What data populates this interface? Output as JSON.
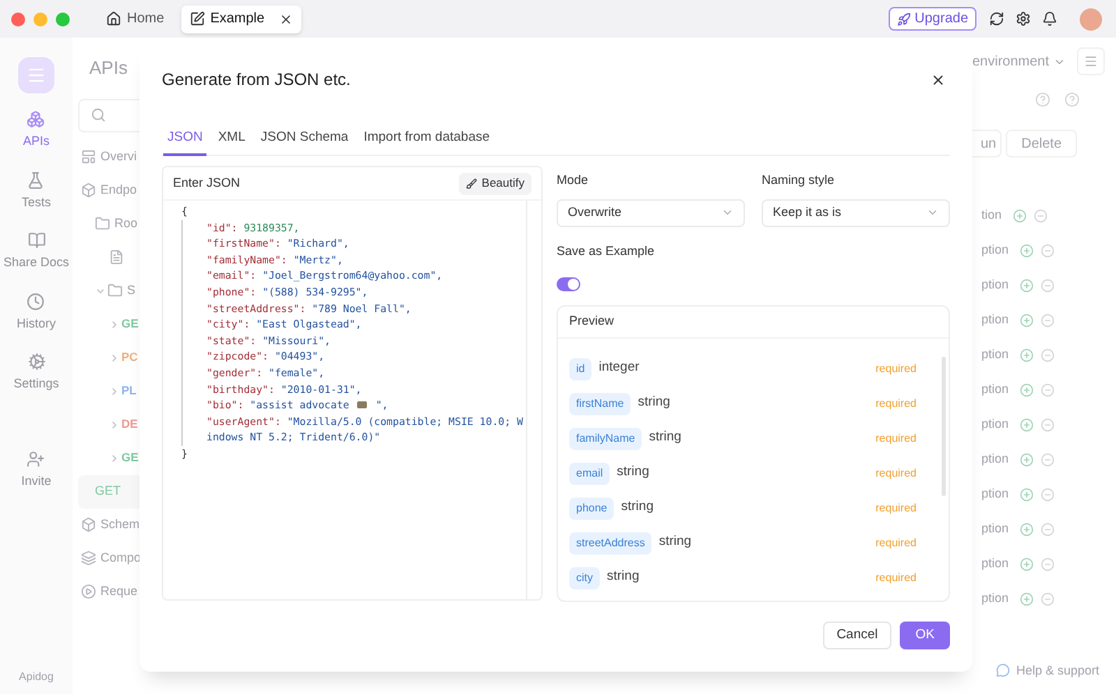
{
  "window_tabs": [
    {
      "label": "Home",
      "selected": false,
      "closable": false
    },
    {
      "label": "Example",
      "selected": true,
      "closable": true
    }
  ],
  "toolbar": {
    "upgrade": "Upgrade"
  },
  "sidebar": {
    "items": [
      {
        "label": "APIs",
        "selected": true
      },
      {
        "label": "Tests",
        "selected": false
      },
      {
        "label": "Share Docs",
        "selected": false
      },
      {
        "label": "History",
        "selected": false
      },
      {
        "label": "Settings",
        "selected": false
      },
      {
        "label": "Invite",
        "selected": false
      }
    ],
    "footer": "Apidog"
  },
  "nav": {
    "title": "APIs",
    "tree": [
      {
        "label": "Overvi",
        "kind": "page"
      },
      {
        "label": "Endpo",
        "kind": "group",
        "children": [
          {
            "label": "Roo",
            "kind": "folder",
            "children": [
              {
                "kind": "doc"
              },
              {
                "label": "S",
                "kind": "folder",
                "expanded": true,
                "children": [
                  {
                    "label": "GE",
                    "kind": "method",
                    "expanded": false,
                    "color": "#7fc9a0"
                  },
                  {
                    "label": "PC",
                    "kind": "method",
                    "expanded": false,
                    "color": "#eeae7c"
                  },
                  {
                    "label": "PL",
                    "kind": "method",
                    "expanded": false,
                    "color": "#8fb4f2"
                  },
                  {
                    "label": "DE",
                    "kind": "method",
                    "expanded": false,
                    "color": "#ee9a90"
                  },
                  {
                    "label": "GE",
                    "kind": "method",
                    "expanded": false,
                    "color": "#7fc9a0"
                  }
                ]
              }
            ]
          },
          {
            "label": "GET",
            "kind": "active",
            "color": "#7fc9a0"
          }
        ]
      },
      {
        "label": "Schem",
        "kind": "schema"
      },
      {
        "label": "Compo",
        "kind": "components"
      },
      {
        "label": "Reque",
        "kind": "request"
      }
    ]
  },
  "main": {
    "environment": "environment",
    "run": "un",
    "delete": "Delete",
    "rows": [
      "tion",
      "ption",
      "ption",
      "ption",
      "ption",
      "ption",
      "ption",
      "ption",
      "ption",
      "ption",
      "ption",
      "ption"
    ],
    "help": "Help & support"
  },
  "dialog": {
    "title": "Generate from JSON etc.",
    "tabs": [
      {
        "label": "JSON",
        "selected": true
      },
      {
        "label": "XML",
        "selected": false
      },
      {
        "label": "JSON Schema",
        "selected": false
      },
      {
        "label": "Import from database",
        "selected": false
      }
    ],
    "editor": {
      "label": "Enter JSON",
      "beautify": "Beautify",
      "lines": [
        {
          "kind": "brace",
          "text": "{"
        },
        {
          "kind": "number",
          "key": "\"id\":",
          "value": "93189357,"
        },
        {
          "kind": "string",
          "key": "\"firstName\":",
          "value": "\"Richard\","
        },
        {
          "kind": "string",
          "key": "\"familyName\":",
          "value": "\"Mertz\","
        },
        {
          "kind": "string",
          "key": "\"email\":",
          "value": "\"Joel_Bergstrom64@yahoo.com\","
        },
        {
          "kind": "string",
          "key": "\"phone\":",
          "value": "\"(588) 534-9295\","
        },
        {
          "kind": "string",
          "key": "\"streetAddress\":",
          "value": "\"789 Noel Fall\","
        },
        {
          "kind": "string",
          "key": "\"city\":",
          "value": "\"East Olgastead\","
        },
        {
          "kind": "string",
          "key": "\"state\":",
          "value": "\"Missouri\","
        },
        {
          "kind": "string",
          "key": "\"zipcode\":",
          "value": "\"04493\","
        },
        {
          "kind": "string",
          "key": "\"gender\":",
          "value": "\"female\","
        },
        {
          "kind": "string",
          "key": "\"birthday\":",
          "value": "\"2010-01-31\","
        },
        {
          "kind": "string",
          "key": "\"bio\":",
          "value": "\"assist advocate",
          "suffix": "\",",
          "emoji": true
        },
        {
          "kind": "string",
          "key": "\"userAgent\":",
          "value": "\"Mozilla/5.0 (compatible; MSIE 10.0; Windows NT 5.2; Trident/6.0)\""
        },
        {
          "kind": "brace",
          "text": "}"
        }
      ]
    },
    "mode": {
      "label": "Mode",
      "value": "Overwrite"
    },
    "naming": {
      "label": "Naming style",
      "value": "Keep it as is"
    },
    "save_example": {
      "label": "Save as Example",
      "on": true
    },
    "preview": {
      "title": "Preview",
      "fields": [
        {
          "name": "id",
          "type": "integer",
          "flag": "required"
        },
        {
          "name": "firstName",
          "type": "string",
          "flag": "required"
        },
        {
          "name": "familyName",
          "type": "string",
          "flag": "required"
        },
        {
          "name": "email",
          "type": "string",
          "flag": "required"
        },
        {
          "name": "phone",
          "type": "string",
          "flag": "required"
        },
        {
          "name": "streetAddress",
          "type": "string",
          "flag": "required"
        },
        {
          "name": "city",
          "type": "string",
          "flag": "required"
        }
      ]
    },
    "buttons": [
      {
        "label": "Cancel",
        "kind": "secondary"
      },
      {
        "label": "OK",
        "kind": "primary"
      }
    ]
  }
}
